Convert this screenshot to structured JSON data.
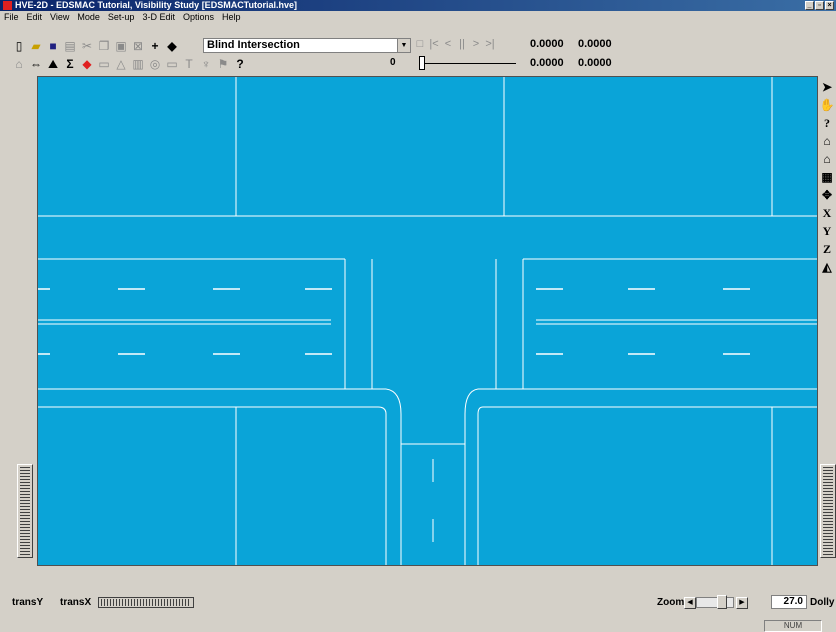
{
  "window": {
    "title": "HVE-2D - EDSMAC Tutorial, Visibility Study [EDSMACTutorial.hve]"
  },
  "menu": [
    "File",
    "Edit",
    "View",
    "Mode",
    "Set-up",
    "3-D Edit",
    "Options",
    "Help"
  ],
  "toolbar": {
    "scenario": "Blind Intersection",
    "coord_x1": "0.0000",
    "coord_y1": "0.0000",
    "coord_x2": "0.0000",
    "coord_y2": "0.0000",
    "frame": "0"
  },
  "right_tools": [
    "arrow-icon",
    "hand-icon",
    "help-icon",
    "home-icon",
    "house-icon",
    "view-icon",
    "rotate-icon",
    "X",
    "Y",
    "Z",
    "perspective-icon"
  ],
  "status": {
    "transY": "transY",
    "transX": "transX",
    "zoom_label": "Zoom",
    "zoom_value": "27.0",
    "dolly": "Dolly",
    "num": "NUM"
  },
  "colors": {
    "viewport_bg": "#0aa4d8",
    "road_line": "#ffffff"
  }
}
